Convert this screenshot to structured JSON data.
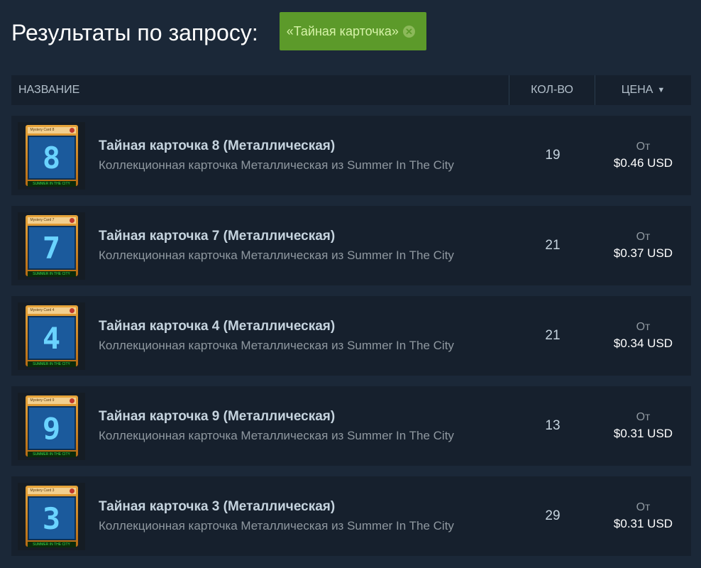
{
  "header": {
    "title": "Результаты по запросу:",
    "search_tag": "«Тайная карточка»",
    "remove_icon": "close-circle-icon"
  },
  "columns": {
    "name": "НАЗВАНИЕ",
    "quantity": "КОЛ-ВО",
    "price": "ЦЕНА",
    "sort_icon": "sort-down-arrow-icon"
  },
  "price_prefix": "От",
  "items": [
    {
      "digit": "8",
      "name": "Тайная карточка 8 (Металлическая)",
      "type": "Коллекционная карточка Металлическая из Summer In The City",
      "quantity": "19",
      "price_from": "От",
      "price": "$0.46 USD",
      "card_caption": "Mystery Card 8",
      "card_footer": "SUMMER IN THE CITY"
    },
    {
      "digit": "7",
      "name": "Тайная карточка 7 (Металлическая)",
      "type": "Коллекционная карточка Металлическая из Summer In The City",
      "quantity": "21",
      "price_from": "От",
      "price": "$0.37 USD",
      "card_caption": "Mystery Card 7",
      "card_footer": "SUMMER IN THE CITY"
    },
    {
      "digit": "4",
      "name": "Тайная карточка 4 (Металлическая)",
      "type": "Коллекционная карточка Металлическая из Summer In The City",
      "quantity": "21",
      "price_from": "От",
      "price": "$0.34 USD",
      "card_caption": "Mystery Card 4",
      "card_footer": "SUMMER IN THE CITY"
    },
    {
      "digit": "9",
      "name": "Тайная карточка 9 (Металлическая)",
      "type": "Коллекционная карточка Металлическая из Summer In The City",
      "quantity": "13",
      "price_from": "От",
      "price": "$0.31 USD",
      "card_caption": "Mystery Card 9",
      "card_footer": "SUMMER IN THE CITY"
    },
    {
      "digit": "3",
      "name": "Тайная карточка 3 (Металлическая)",
      "type": "Коллекционная карточка Металлическая из Summer In The City",
      "quantity": "29",
      "price_from": "От",
      "price": "$0.31 USD",
      "card_caption": "Mystery Card 3",
      "card_footer": "SUMMER IN THE CITY"
    }
  ],
  "colors": {
    "background": "#1b2838",
    "row": "#16202d",
    "tag": "#5c9a2a"
  }
}
